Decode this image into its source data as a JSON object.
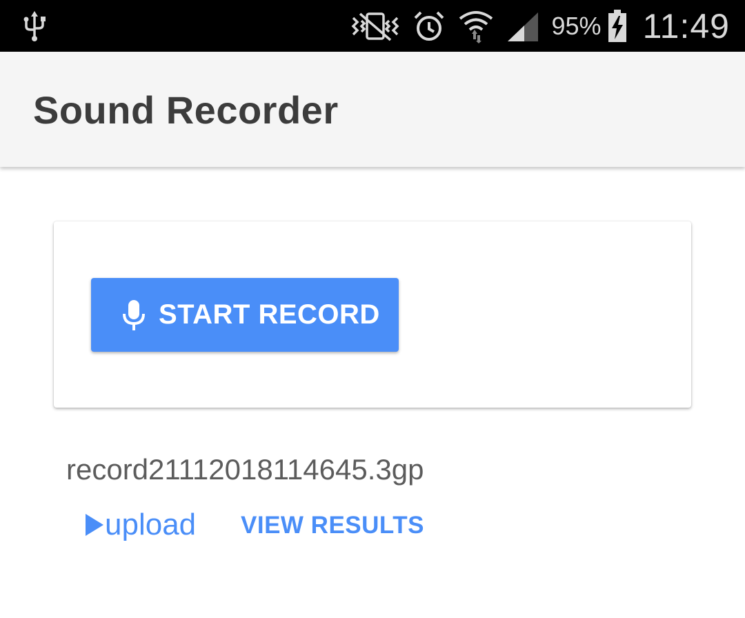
{
  "status_bar": {
    "icons": [
      "usb-icon",
      "vibrate-mute-icon",
      "alarm-icon",
      "wifi-icon",
      "signal-icon",
      "battery-charging-icon"
    ],
    "battery_percent": "95%",
    "time": "11:49"
  },
  "app_bar": {
    "title": "Sound Recorder"
  },
  "record_card": {
    "start_record_label": "START RECORD",
    "button_color": "#4a8ef8"
  },
  "recording": {
    "filename": "record21112018114645.3gp",
    "upload_label": "upload",
    "view_results_label": "VIEW RESULTS",
    "link_color": "#4a8ef8"
  }
}
